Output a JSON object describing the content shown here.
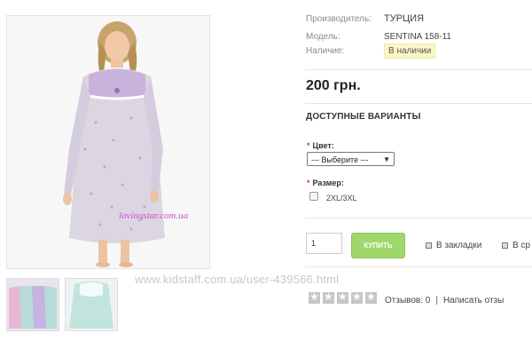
{
  "product": {
    "maker_label": "Производитель:",
    "maker_value": "ТУРЦИЯ",
    "model_label": "Модель:",
    "model_value": "SENTINA 158-11",
    "stock_label": "Наличие:",
    "stock_value": "В наличии",
    "price": "200 грн."
  },
  "image": {
    "watermark": "lovingstar.com.ua"
  },
  "options": {
    "title": "ДОСТУПНЫЕ ВАРИАНТЫ",
    "required_mark": "*",
    "color_label": "Цвет:",
    "color_selected": "--- Выберите ---",
    "size_label": "Размер:",
    "size_option": "2XL/3XL"
  },
  "cart": {
    "qty": "1",
    "buy_label": "КУПИТЬ",
    "bookmark_label": "В закладки",
    "compare_label": "В ср"
  },
  "reviews": {
    "rating": 0,
    "reviews_text": "Отзывов: 0",
    "separator": "|",
    "write_text": "Написать отзы"
  },
  "site_watermark": "www.kidstaff.com.ua/user-439566.html",
  "colors": {
    "buy_button": "#9fd86a",
    "stock_badge": "#fbf6c5",
    "required": "#e53a3a"
  }
}
